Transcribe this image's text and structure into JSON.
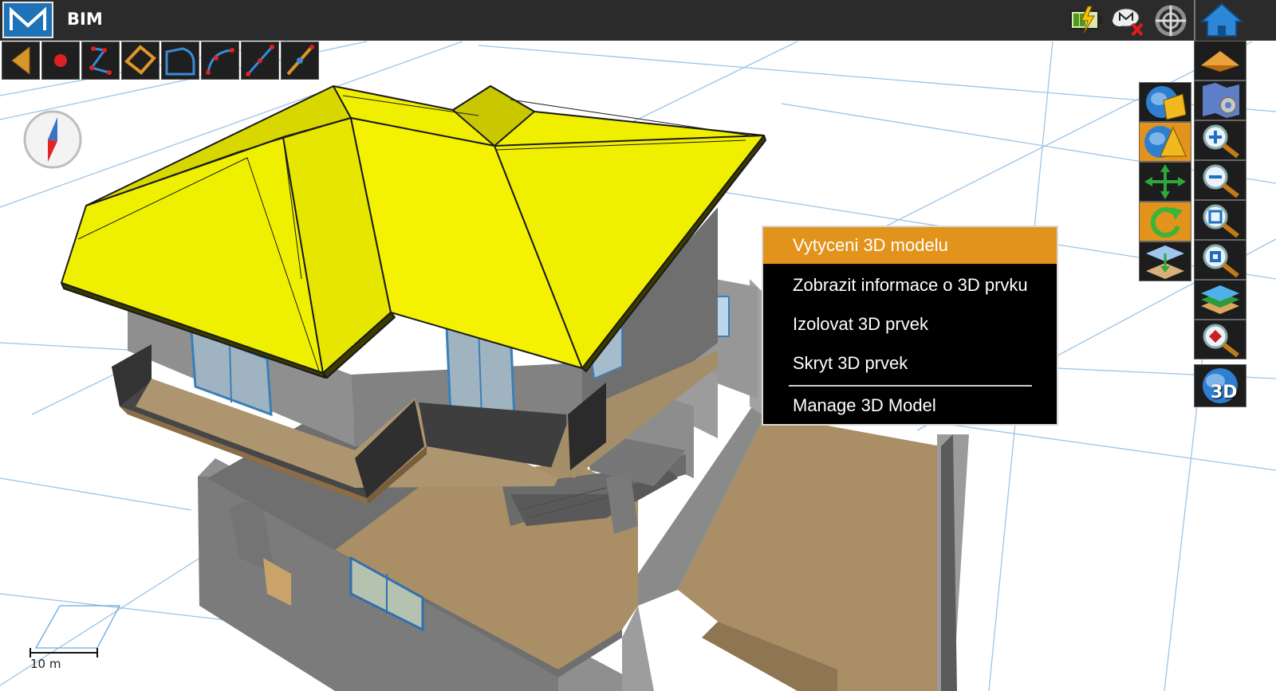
{
  "app": {
    "logo_letter": "M",
    "title": "BIM"
  },
  "status_icons": [
    "battery-charging-icon",
    "cloud-disconnected-icon",
    "gps-sync-icon"
  ],
  "home_icon": "home-icon",
  "toolbar": {
    "tools": [
      {
        "name": "back-arrow-icon"
      },
      {
        "name": "point-icon"
      },
      {
        "name": "polyline-icon"
      },
      {
        "name": "polygon-icon"
      },
      {
        "name": "rectangle-curve-icon"
      },
      {
        "name": "arc-icon"
      },
      {
        "name": "line-icon"
      },
      {
        "name": "offset-line-icon"
      }
    ]
  },
  "left_panel_buttons": [
    "globe-cube-icon",
    "globe-pyramid-icon",
    "pan-arrows-icon",
    "rotate-icon",
    "layers-flip-icon"
  ],
  "right_panel_buttons": [
    "pyramid-view-icon",
    "map-settings-icon",
    "zoom-in-icon",
    "zoom-out-icon",
    "zoom-extent-icon",
    "zoom-fit-icon",
    "layers-icon",
    "zoom-point-icon",
    "globe-3d-icon"
  ],
  "right_panel_3d_label": "3D",
  "scale": {
    "label": "10 m"
  },
  "context_menu": {
    "items": [
      {
        "label": "Vytyceni 3D modelu",
        "active": true
      },
      {
        "label": "Zobrazit informace o 3D prvku",
        "active": false
      },
      {
        "label": "Izolovat 3D prvek",
        "active": false
      },
      {
        "label": "Skryt 3D prvek",
        "active": false
      },
      {
        "label": "Manage 3D Model",
        "active": false
      }
    ]
  },
  "colors": {
    "accent": "#e1931b",
    "roof": "#f2ef00",
    "brand": "#1e73b8",
    "bar": "#2b2b2b"
  }
}
